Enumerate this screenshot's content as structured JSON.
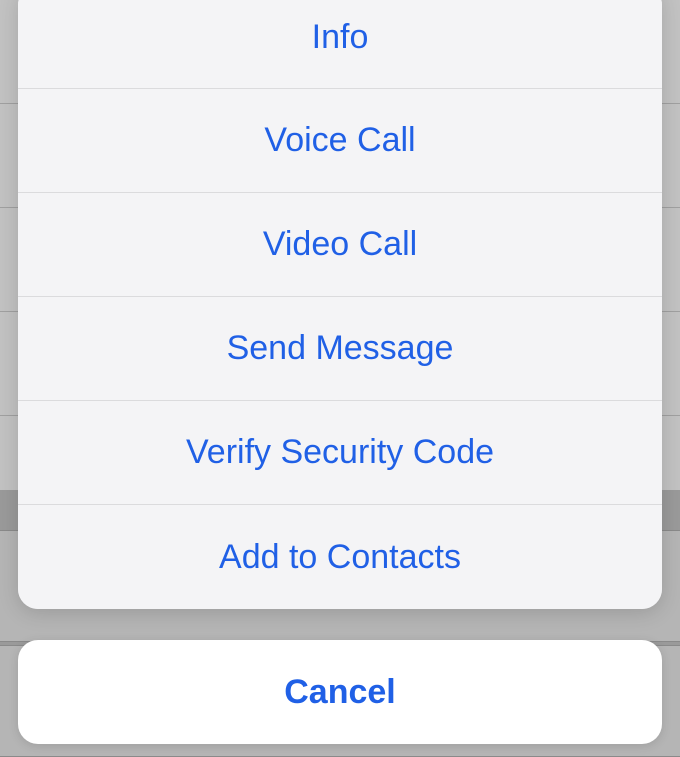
{
  "actionSheet": {
    "options": [
      {
        "label": "Info"
      },
      {
        "label": "Voice Call"
      },
      {
        "label": "Video Call"
      },
      {
        "label": "Send Message"
      },
      {
        "label": "Verify Security Code"
      },
      {
        "label": "Add to Contacts"
      }
    ],
    "cancelLabel": "Cancel"
  },
  "colors": {
    "accent": "#2060e6",
    "sheetBg": "#f2f2f4",
    "cancelBg": "#ffffff"
  }
}
